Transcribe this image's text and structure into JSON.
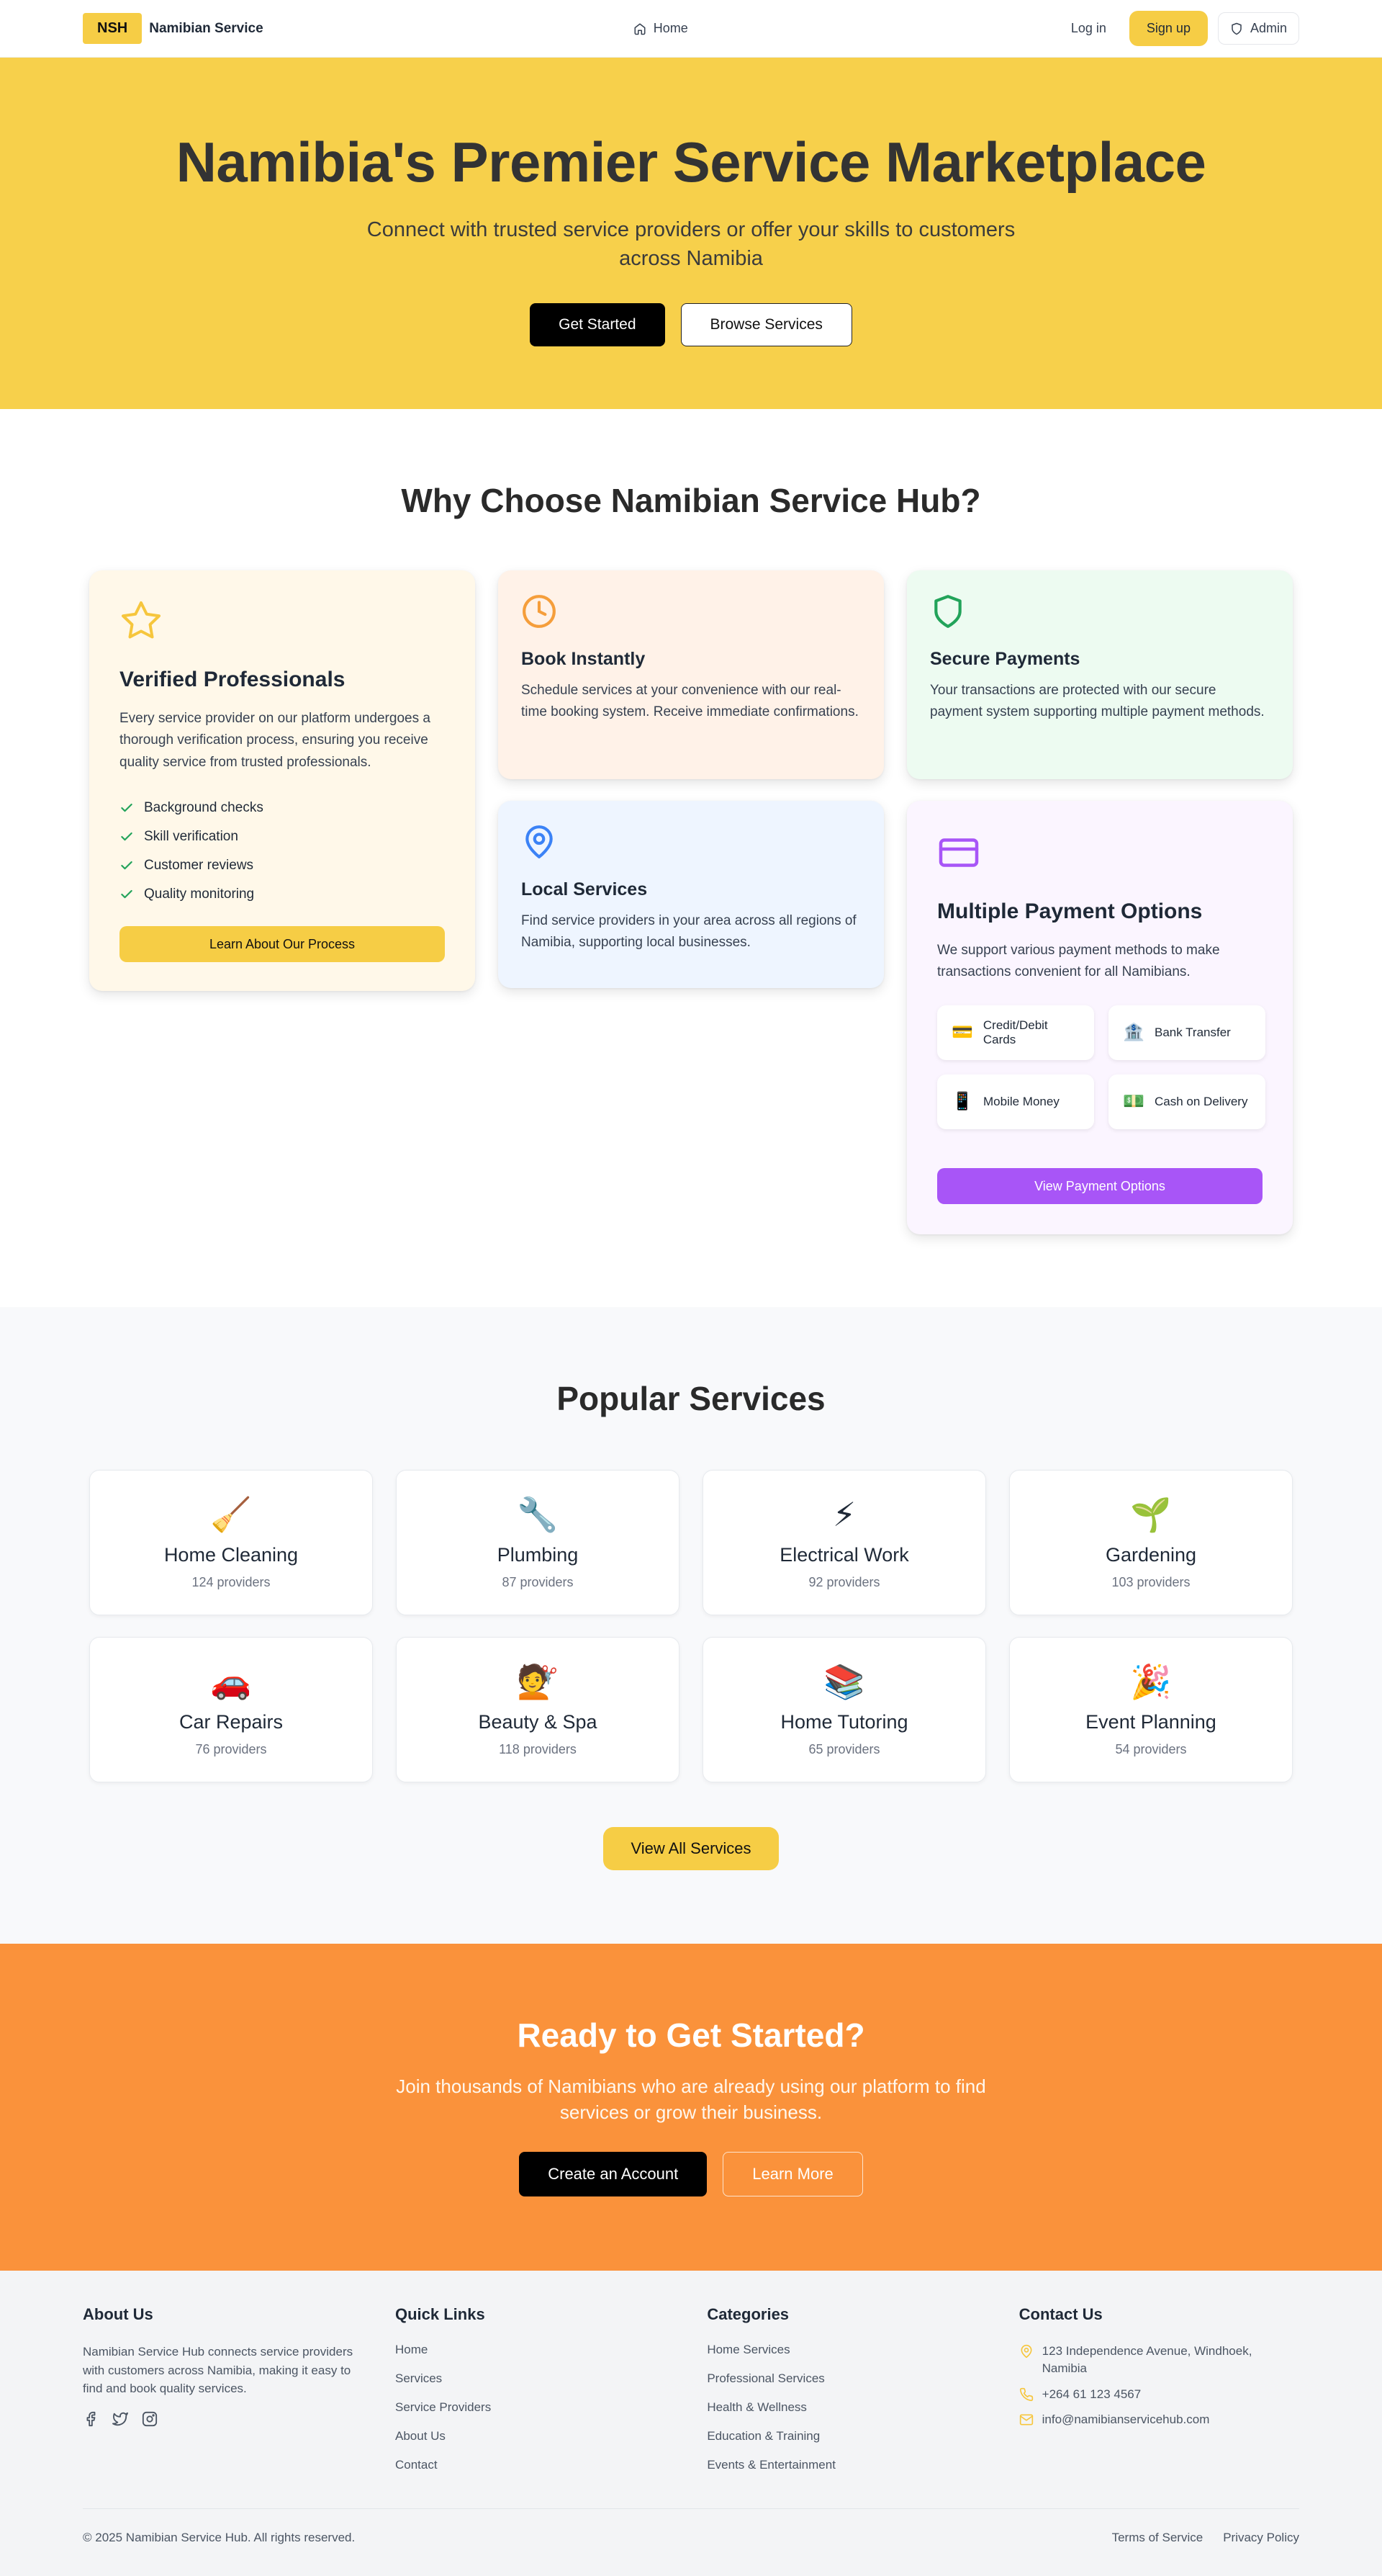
{
  "header": {
    "logo": "NSH",
    "brand": "Namibian Service",
    "nav_home": "Home",
    "login": "Log in",
    "signup": "Sign up",
    "admin": "Admin",
    "accent": "#f6cd45"
  },
  "hero": {
    "title": "Namibia's Premier Service Marketplace",
    "subtitle": "Connect with trusted service providers or offer your skills to customers across Namibia",
    "primary_cta": "Get Started",
    "secondary_cta": "Browse Services",
    "background": "#f7d04b"
  },
  "why": {
    "title": "Why Choose Namibian Service Hub?",
    "verified": {
      "icon": "star-icon",
      "title": "Verified Professionals",
      "description": "Every service provider on our platform undergoes a thorough verification process, ensuring you receive quality service from trusted professionals.",
      "checks": [
        "Background checks",
        "Skill verification",
        "Customer reviews",
        "Quality monitoring"
      ],
      "button": "Learn About Our Process"
    },
    "book": {
      "icon": "clock-icon",
      "title": "Book Instantly",
      "description": "Schedule services at your convenience with our real-time booking system. Receive immediate confirmations."
    },
    "secure": {
      "icon": "shield-icon",
      "title": "Secure Payments",
      "description": "Your transactions are protected with our secure payment system supporting multiple payment methods."
    },
    "local": {
      "icon": "map-pin-icon",
      "title": "Local Services",
      "description": "Find service providers in your area across all regions of Namibia, supporting local businesses."
    },
    "payment": {
      "icon": "credit-card-icon",
      "title": "Multiple Payment Options",
      "description": "We support various payment methods to make transactions convenient for all Namibians.",
      "methods": [
        {
          "emoji": "💳",
          "label": "Credit/Debit Cards"
        },
        {
          "emoji": "🏦",
          "label": "Bank Transfer"
        },
        {
          "emoji": "📱",
          "label": "Mobile Money"
        },
        {
          "emoji": "💵",
          "label": "Cash on Delivery"
        }
      ],
      "button": "View Payment Options",
      "accent": "#a855f7"
    }
  },
  "popular": {
    "title": "Popular Services",
    "services": [
      {
        "emoji": "🧹",
        "name": "Home Cleaning",
        "count": "124 providers"
      },
      {
        "emoji": "🔧",
        "name": "Plumbing",
        "count": "87 providers"
      },
      {
        "emoji": "⚡",
        "name": "Electrical Work",
        "count": "92 providers"
      },
      {
        "emoji": "🌱",
        "name": "Gardening",
        "count": "103 providers"
      },
      {
        "emoji": "🚗",
        "name": "Car Repairs",
        "count": "76 providers"
      },
      {
        "emoji": "💇",
        "name": "Beauty & Spa",
        "count": "118 providers"
      },
      {
        "emoji": "📚",
        "name": "Home Tutoring",
        "count": "65 providers"
      },
      {
        "emoji": "🎉",
        "name": "Event Planning",
        "count": "54 providers"
      }
    ],
    "view_all": "View All Services"
  },
  "cta": {
    "title": "Ready to Get Started?",
    "subtitle": "Join thousands of Namibians who are already using our platform to find services or grow their business.",
    "primary": "Create an Account",
    "secondary": "Learn More",
    "background": "#fa923b"
  },
  "footer": {
    "about": {
      "title": "About Us",
      "text": "Namibian Service Hub connects service providers with customers across Namibia, making it easy to find and book quality services.",
      "social": [
        "facebook-icon",
        "twitter-icon",
        "instagram-icon"
      ]
    },
    "quick_links": {
      "title": "Quick Links",
      "items": [
        "Home",
        "Services",
        "Service Providers",
        "About Us",
        "Contact"
      ]
    },
    "categories": {
      "title": "Categories",
      "items": [
        "Home Services",
        "Professional Services",
        "Health & Wellness",
        "Education & Training",
        "Events & Entertainment"
      ]
    },
    "contact": {
      "title": "Contact Us",
      "address": "123 Independence Avenue, Windhoek, Namibia",
      "phone": "+264 61 123 4567",
      "email": "info@namibianservicehub.com"
    },
    "copyright": "© 2025 Namibian Service Hub. All rights reserved.",
    "terms": "Terms of Service",
    "privacy": "Privacy Policy"
  }
}
